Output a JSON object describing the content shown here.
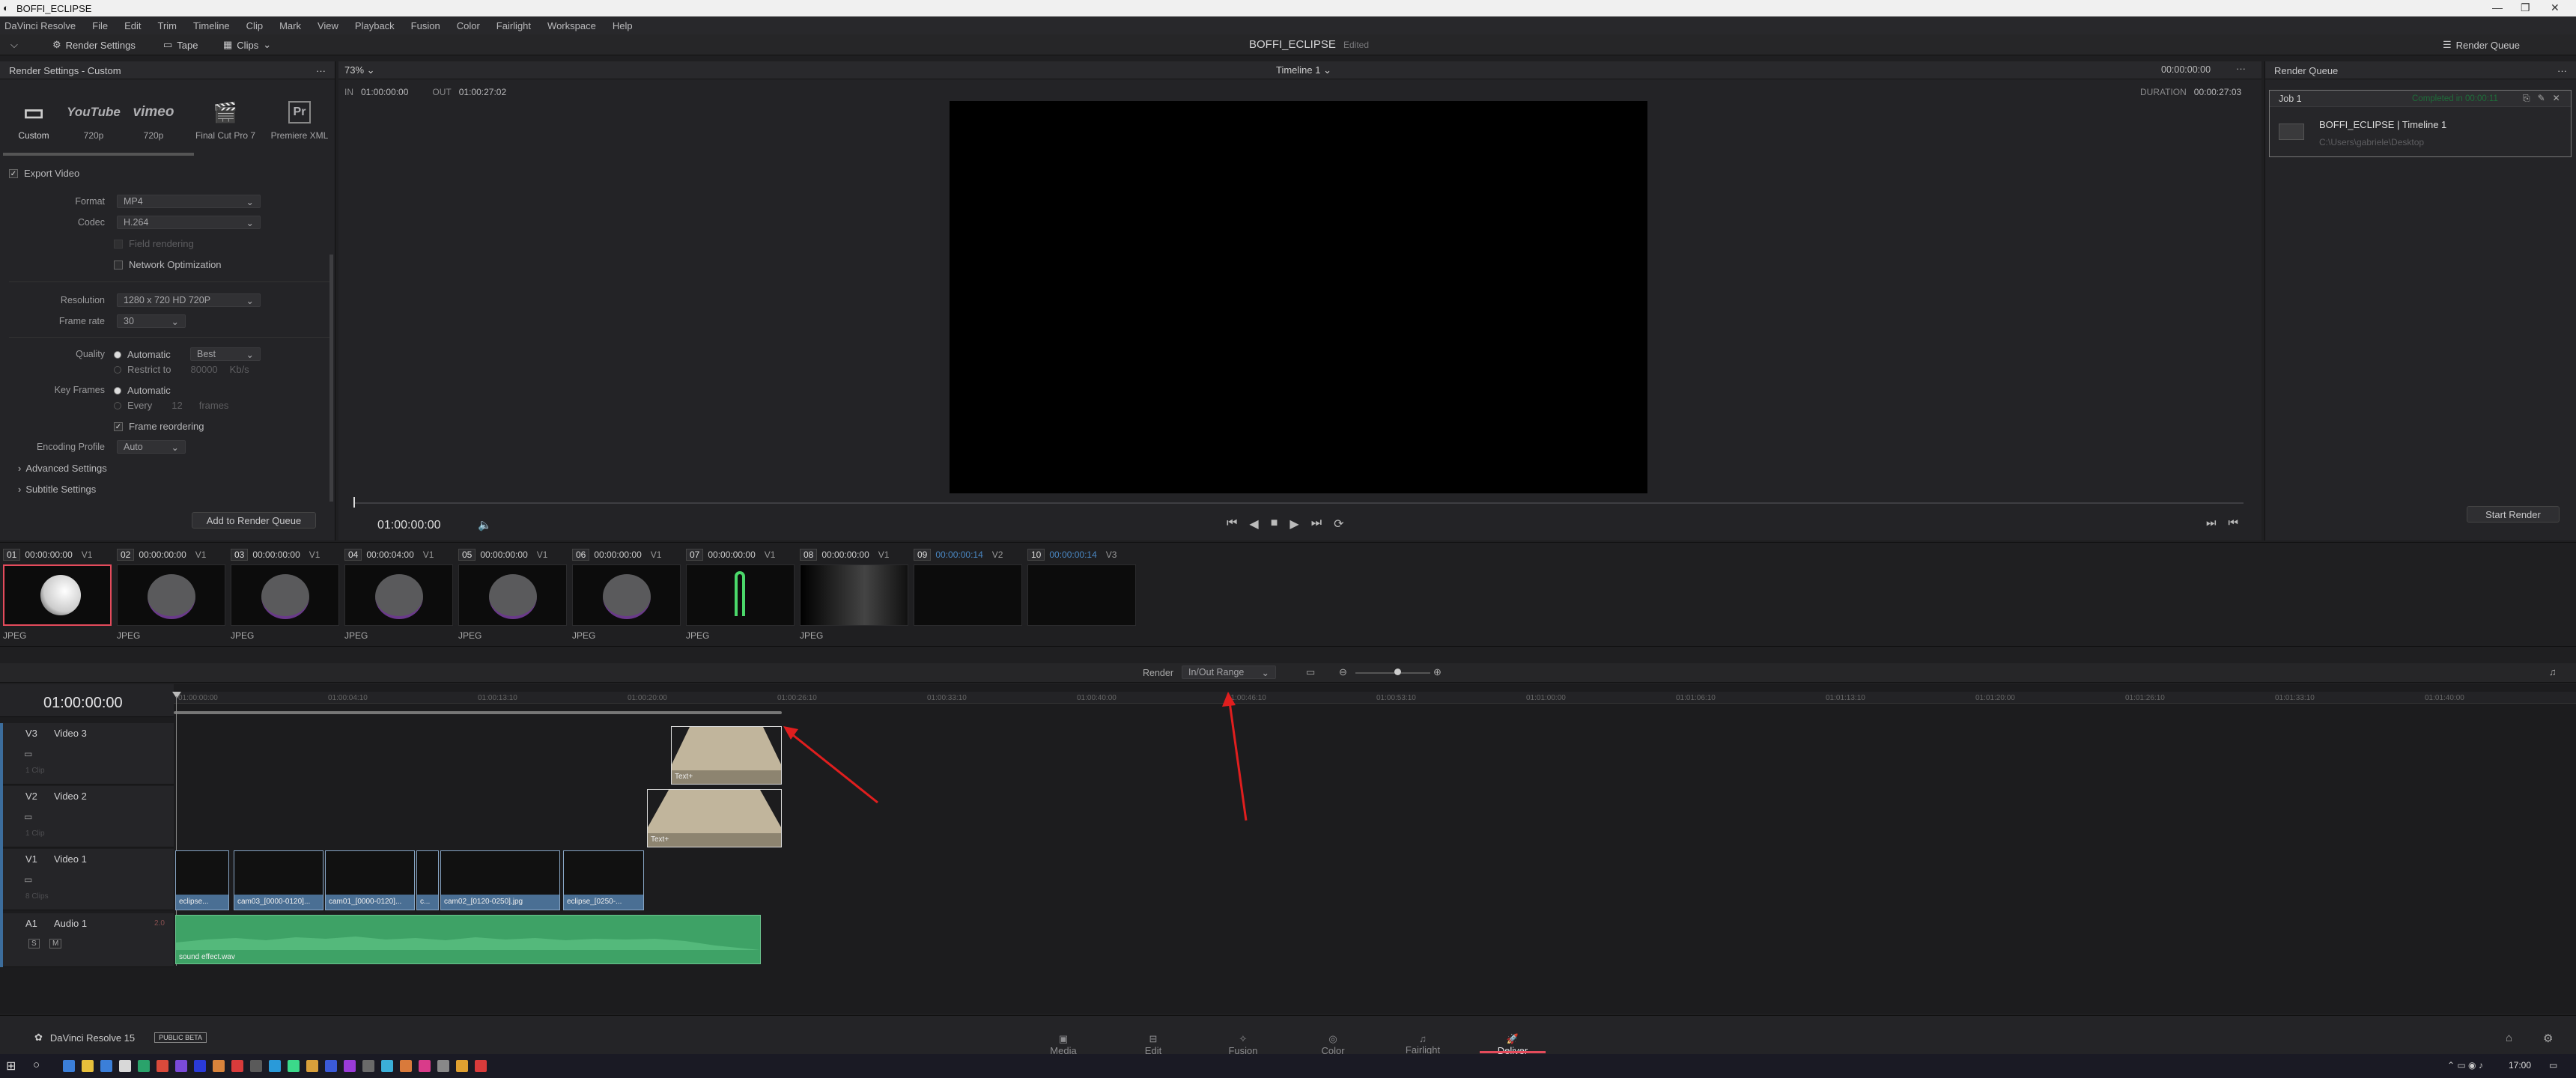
{
  "window": {
    "title": "BOFFI_ECLIPSE"
  },
  "menu": [
    "DaVinci Resolve",
    "File",
    "Edit",
    "Trim",
    "Timeline",
    "Clip",
    "Mark",
    "View",
    "Playback",
    "Fusion",
    "Color",
    "Fairlight",
    "Workspace",
    "Help"
  ],
  "toolbar": {
    "render_settings": "Render Settings",
    "tape": "Tape",
    "clips": "Clips",
    "project_title": "BOFFI_ECLIPSE",
    "edited": "Edited",
    "render_queue": "Render Queue"
  },
  "render_settings": {
    "title": "Render Settings - Custom",
    "presets": [
      {
        "icon": "▭",
        "label": "Custom"
      },
      {
        "icon": "YouTube",
        "label": "720p"
      },
      {
        "icon": "vimeo",
        "label": "720p"
      },
      {
        "icon": "🎬",
        "label": "Final Cut Pro 7"
      },
      {
        "icon": "Pr",
        "label": "Premiere XML"
      }
    ],
    "export_video": "Export Video",
    "format_label": "Format",
    "format": "MP4",
    "codec_label": "Codec",
    "codec": "H.264",
    "field_rendering": "Field rendering",
    "network_opt": "Network Optimization",
    "resolution_label": "Resolution",
    "resolution": "1280 x 720 HD 720P",
    "framerate_label": "Frame rate",
    "framerate": "30",
    "quality_label": "Quality",
    "quality_auto": "Automatic",
    "quality_best": "Best",
    "restrict_to": "Restrict to",
    "restrict_val": "80000",
    "kbps": "Kb/s",
    "keyframes_label": "Key Frames",
    "kf_auto": "Automatic",
    "kf_every": "Every",
    "kf_val": "12",
    "kf_frames": "frames",
    "frame_reordering": "Frame reordering",
    "encoding_label": "Encoding Profile",
    "encoding": "Auto",
    "advanced": "Advanced Settings",
    "subtitle": "Subtitle Settings",
    "add_queue": "Add to Render Queue"
  },
  "viewer": {
    "zoom": "73%",
    "timeline_name": "Timeline 1",
    "in_label": "IN",
    "in_tc": "01:00:00:00",
    "out_label": "OUT",
    "out_tc": "01:00:27:02",
    "tc_right": "00:00:00:00",
    "duration_label": "DURATION",
    "duration": "00:00:27:03",
    "playhead_tc": "01:00:00:00"
  },
  "render_queue": {
    "title": "Render Queue",
    "job": "Job 1",
    "completed": "Completed in 00:00:11",
    "job_title": "BOFFI_ECLIPSE | Timeline 1",
    "job_path": "C:\\Users\\gabriele\\Desktop",
    "start": "Start Render"
  },
  "clips": [
    {
      "n": "01",
      "tc": "00:00:00:00",
      "track": "V1",
      "fmt": "JPEG"
    },
    {
      "n": "02",
      "tc": "00:00:00:00",
      "track": "V1",
      "fmt": "JPEG"
    },
    {
      "n": "03",
      "tc": "00:00:00:00",
      "track": "V1",
      "fmt": "JPEG"
    },
    {
      "n": "04",
      "tc": "00:00:04:00",
      "track": "V1",
      "fmt": "JPEG"
    },
    {
      "n": "05",
      "tc": "00:00:00:00",
      "track": "V1",
      "fmt": "JPEG"
    },
    {
      "n": "06",
      "tc": "00:00:00:00",
      "track": "V1",
      "fmt": "JPEG"
    },
    {
      "n": "07",
      "tc": "00:00:00:00",
      "track": "V1",
      "fmt": "JPEG"
    },
    {
      "n": "08",
      "tc": "00:00:00:00",
      "track": "V1",
      "fmt": "JPEG"
    },
    {
      "n": "09",
      "tc": "00:00:00:14",
      "track": "V2",
      "fmt": ""
    },
    {
      "n": "10",
      "tc": "00:00:00:14",
      "track": "V3",
      "fmt": ""
    }
  ],
  "timeline": {
    "render_label": "Render",
    "render_range": "In/Out Range",
    "tc": "01:00:00:00",
    "ruler": [
      "01:00:00:00",
      "01:00:04:10",
      "01:00:13:10",
      "01:00:20:00",
      "01:00:26:10",
      "01:00:33:10",
      "01:00:40:00",
      "01:00:46:10",
      "01:00:53:10",
      "01:01:00:00",
      "01:01:06:10",
      "01:01:13:10",
      "01:01:20:00",
      "01:01:26:10",
      "01:01:33:10",
      "01:01:40:00"
    ],
    "tracks": [
      {
        "id": "V3",
        "name": "Video 3",
        "count": "1 Clip"
      },
      {
        "id": "V2",
        "name": "Video 2",
        "count": "1 Clip"
      },
      {
        "id": "V1",
        "name": "Video 1",
        "count": "8 Clips"
      },
      {
        "id": "A1",
        "name": "Audio 1",
        "ch": "2.0"
      }
    ],
    "v1_clips": [
      "eclipse...",
      "cam03_[0000-0120]...",
      "cam01_[0000-0120]...",
      "c...",
      "cam02_[0120-0250].jpg",
      "eclipse_[0250-..."
    ],
    "text_clip": "Text+",
    "audio_clip": "sound effect.wav"
  },
  "footer": {
    "app": "DaVinci Resolve 15",
    "beta": "PUBLIC BETA",
    "pages": [
      "Media",
      "Edit",
      "Fusion",
      "Color",
      "Fairlight",
      "Deliver"
    ]
  },
  "taskbar": {
    "time": "17:00"
  },
  "colors": {
    "accent": "#e44b5c",
    "clip_blue": "#4a6f94",
    "audio_green": "#3ea266",
    "arrow": "#e01e1e"
  }
}
